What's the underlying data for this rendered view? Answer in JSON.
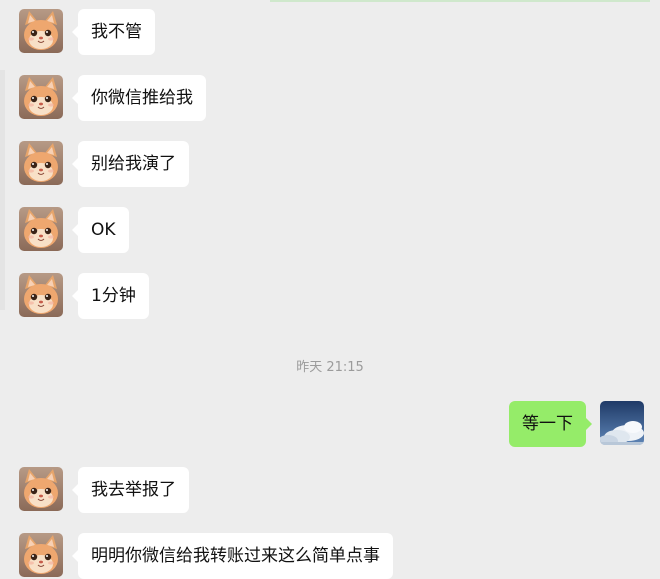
{
  "messages": [
    {
      "side": "left",
      "text": "我不管"
    },
    {
      "side": "left",
      "text": "你微信推给我"
    },
    {
      "side": "left",
      "text": "别给我演了"
    },
    {
      "side": "left",
      "text": "OK"
    },
    {
      "side": "left",
      "text": "1分钟"
    },
    {
      "side": "right",
      "text": "等一下"
    },
    {
      "side": "left",
      "text": "我去举报了"
    },
    {
      "side": "left",
      "text": "明明你微信给我转账过来这么简单点事"
    }
  ],
  "timestamp": "昨天 21:15",
  "colors": {
    "background": "#ededed",
    "incoming_bubble": "#ffffff",
    "outgoing_bubble": "#95ec69",
    "text": "#111111",
    "timestamp": "#9b9b9b"
  },
  "icons": {
    "incoming_avatar": "cartoon-cat-avatar",
    "outgoing_avatar": "sky-clouds-avatar"
  }
}
